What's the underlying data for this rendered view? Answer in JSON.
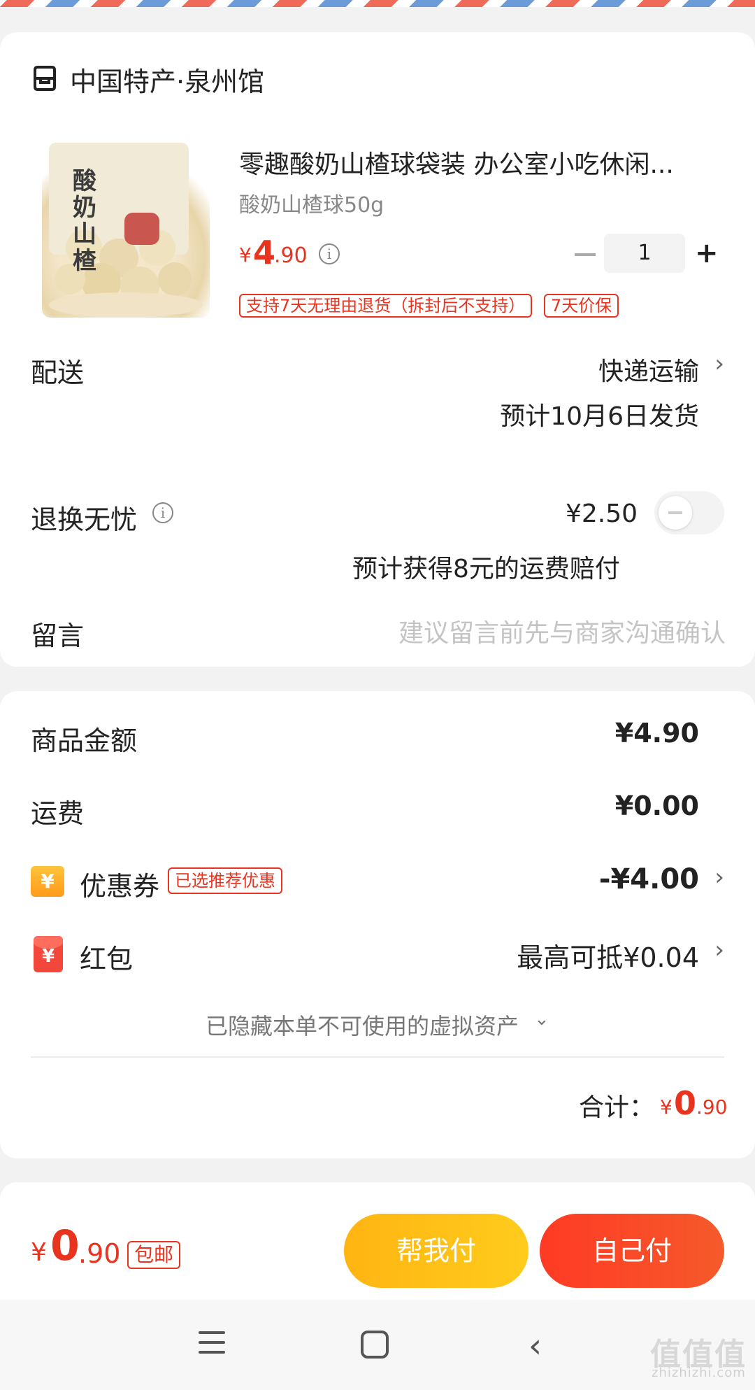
{
  "store": {
    "name": "中国特产·泉州馆",
    "icon": "store-icon"
  },
  "product": {
    "title": "零趣酸奶山楂球袋装 办公室小吃休闲...",
    "spec": "酸奶山楂球50g",
    "price_symbol": "¥",
    "price_int": "4",
    "price_dec": ".90",
    "quantity": "1",
    "tags": [
      "支持7天无理由退货（拆封后不支持）",
      "7天价保"
    ],
    "image_alt": "酸奶山楂"
  },
  "delivery": {
    "label": "配送",
    "method": "快递运输",
    "eta": "预计10月6日发货"
  },
  "return_insurance": {
    "label": "退换无忧",
    "price": "¥2.50",
    "note": "预计获得8元的运费赔付",
    "enabled": false
  },
  "message": {
    "label": "留言",
    "placeholder": "建议留言前先与商家沟通确认"
  },
  "summary": {
    "goods_label": "商品金额",
    "goods_value": "¥4.90",
    "shipping_label": "运费",
    "shipping_value": "¥0.00",
    "coupon_label": "优惠券",
    "coupon_tag": "已选推荐优惠",
    "coupon_value": "-¥4.00",
    "redpack_label": "红包",
    "redpack_value": "最高可抵¥0.04",
    "hidden_assets": "已隐藏本单不可使用的虚拟资产",
    "total_label": "合计：",
    "total_symbol": "¥",
    "total_int": "0",
    "total_dec": ".90"
  },
  "footer": {
    "price_symbol": "¥",
    "price_int": "0",
    "price_dec": ".90",
    "free_shipping": "包邮",
    "help_pay": "帮我付",
    "self_pay": "自己付"
  },
  "watermark": {
    "main": "值值值",
    "sub": "zhizhizhi.com"
  },
  "colors": {
    "accent": "#e8341f",
    "help_btn": "#ffc01a",
    "self_btn": "#f4462a"
  }
}
